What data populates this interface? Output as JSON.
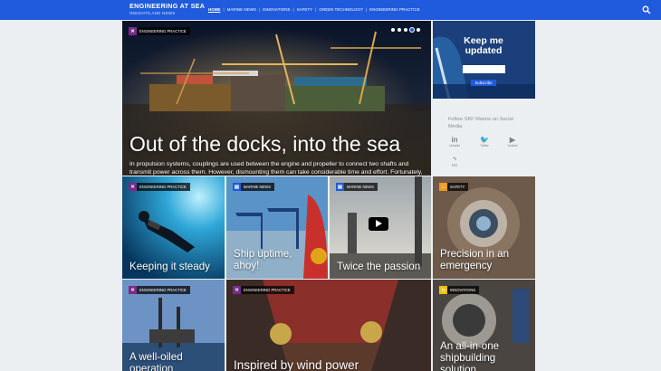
{
  "header": {
    "brand_title": "ENGINEERING AT SEA",
    "brand_subtitle": "INSIGHTS AND NEWS",
    "nav": [
      {
        "label": "HOME",
        "active": true
      },
      {
        "label": "MARINE NEWS",
        "active": false
      },
      {
        "label": "INNOVATIONS",
        "active": false
      },
      {
        "label": "SAFETY",
        "active": false
      },
      {
        "label": "GREEN TECHNOLOGY",
        "active": false
      },
      {
        "label": "ENGINEERING PRACTICE",
        "active": false
      }
    ],
    "separator": "|",
    "search_icon": "search-icon"
  },
  "hero": {
    "category": "ENGINEERING PRACTICE",
    "title": "Out of the docks, into the sea",
    "description": "In propulsion systems, couplings are used between the engine and propeller to connect two shafts and transmit power across them. However, dismounting them can take considerable time and effort. Fortunately, there are effective ways to solve this challenge.",
    "slide_count": 5,
    "active_slide": 4
  },
  "newsletter": {
    "title_line1": "Keep me",
    "title_line2": "updated",
    "email_placeholder": "",
    "subscribe_label": "Subscribe"
  },
  "social": {
    "follow_text": "Follow SKF Marine on Social Media",
    "links": [
      {
        "glyph": "in",
        "label": "LinkedIn",
        "icon": "linkedin-icon"
      },
      {
        "glyph": "🐦",
        "label": "Twitter",
        "icon": "twitter-icon"
      },
      {
        "glyph": "▶",
        "label": "Youtube",
        "icon": "youtube-icon"
      },
      {
        "glyph": "◝",
        "label": "RSS",
        "icon": "rss-icon"
      }
    ]
  },
  "articles": [
    {
      "category": "ENGINEERING PRACTICE",
      "title": "Keeping it steady"
    },
    {
      "category": "MARINE NEWS",
      "title": "Ship uptime, ahoy!"
    },
    {
      "category": "MARINE NEWS",
      "title": "Twice the passion",
      "video": true
    },
    {
      "category": "SAFETY",
      "title": "Precision in an emergency"
    },
    {
      "category": "ENGINEERING PRACTICE",
      "title": "A well-oiled operation"
    },
    {
      "category": "ENGINEERING PRACTICE",
      "title": "Inspired by wind power"
    },
    {
      "category": "INNOVATIONS",
      "title": "An all-in-one shipbuilding solution"
    }
  ],
  "colors": {
    "brand_blue": "#1f5bdc",
    "engineering_practice": "#7a2a8c",
    "marine_news": "#1f5bdc",
    "safety": "#f09a1a",
    "innovations": "#f2c200"
  }
}
